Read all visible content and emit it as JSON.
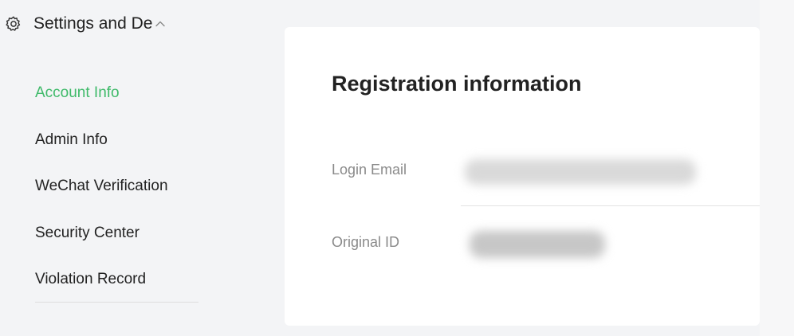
{
  "sidebar": {
    "header_title": "Settings and De",
    "items": [
      {
        "label": "Account Info",
        "active": true
      },
      {
        "label": "Admin Info",
        "active": false
      },
      {
        "label": "WeChat Verification",
        "active": false
      },
      {
        "label": "Security Center",
        "active": false
      },
      {
        "label": "Violation Record",
        "active": false
      }
    ],
    "icons": {
      "header": "gear-icon",
      "toggle": "chevron-up-icon"
    }
  },
  "main": {
    "title": "Registration information",
    "fields": [
      {
        "label": "Login Email",
        "value": ""
      },
      {
        "label": "Original ID",
        "value": ""
      }
    ]
  },
  "colors": {
    "active": "#3fba6a",
    "page_bg": "#f3f4f6",
    "card_bg": "#ffffff",
    "label": "#8a8a8a"
  }
}
